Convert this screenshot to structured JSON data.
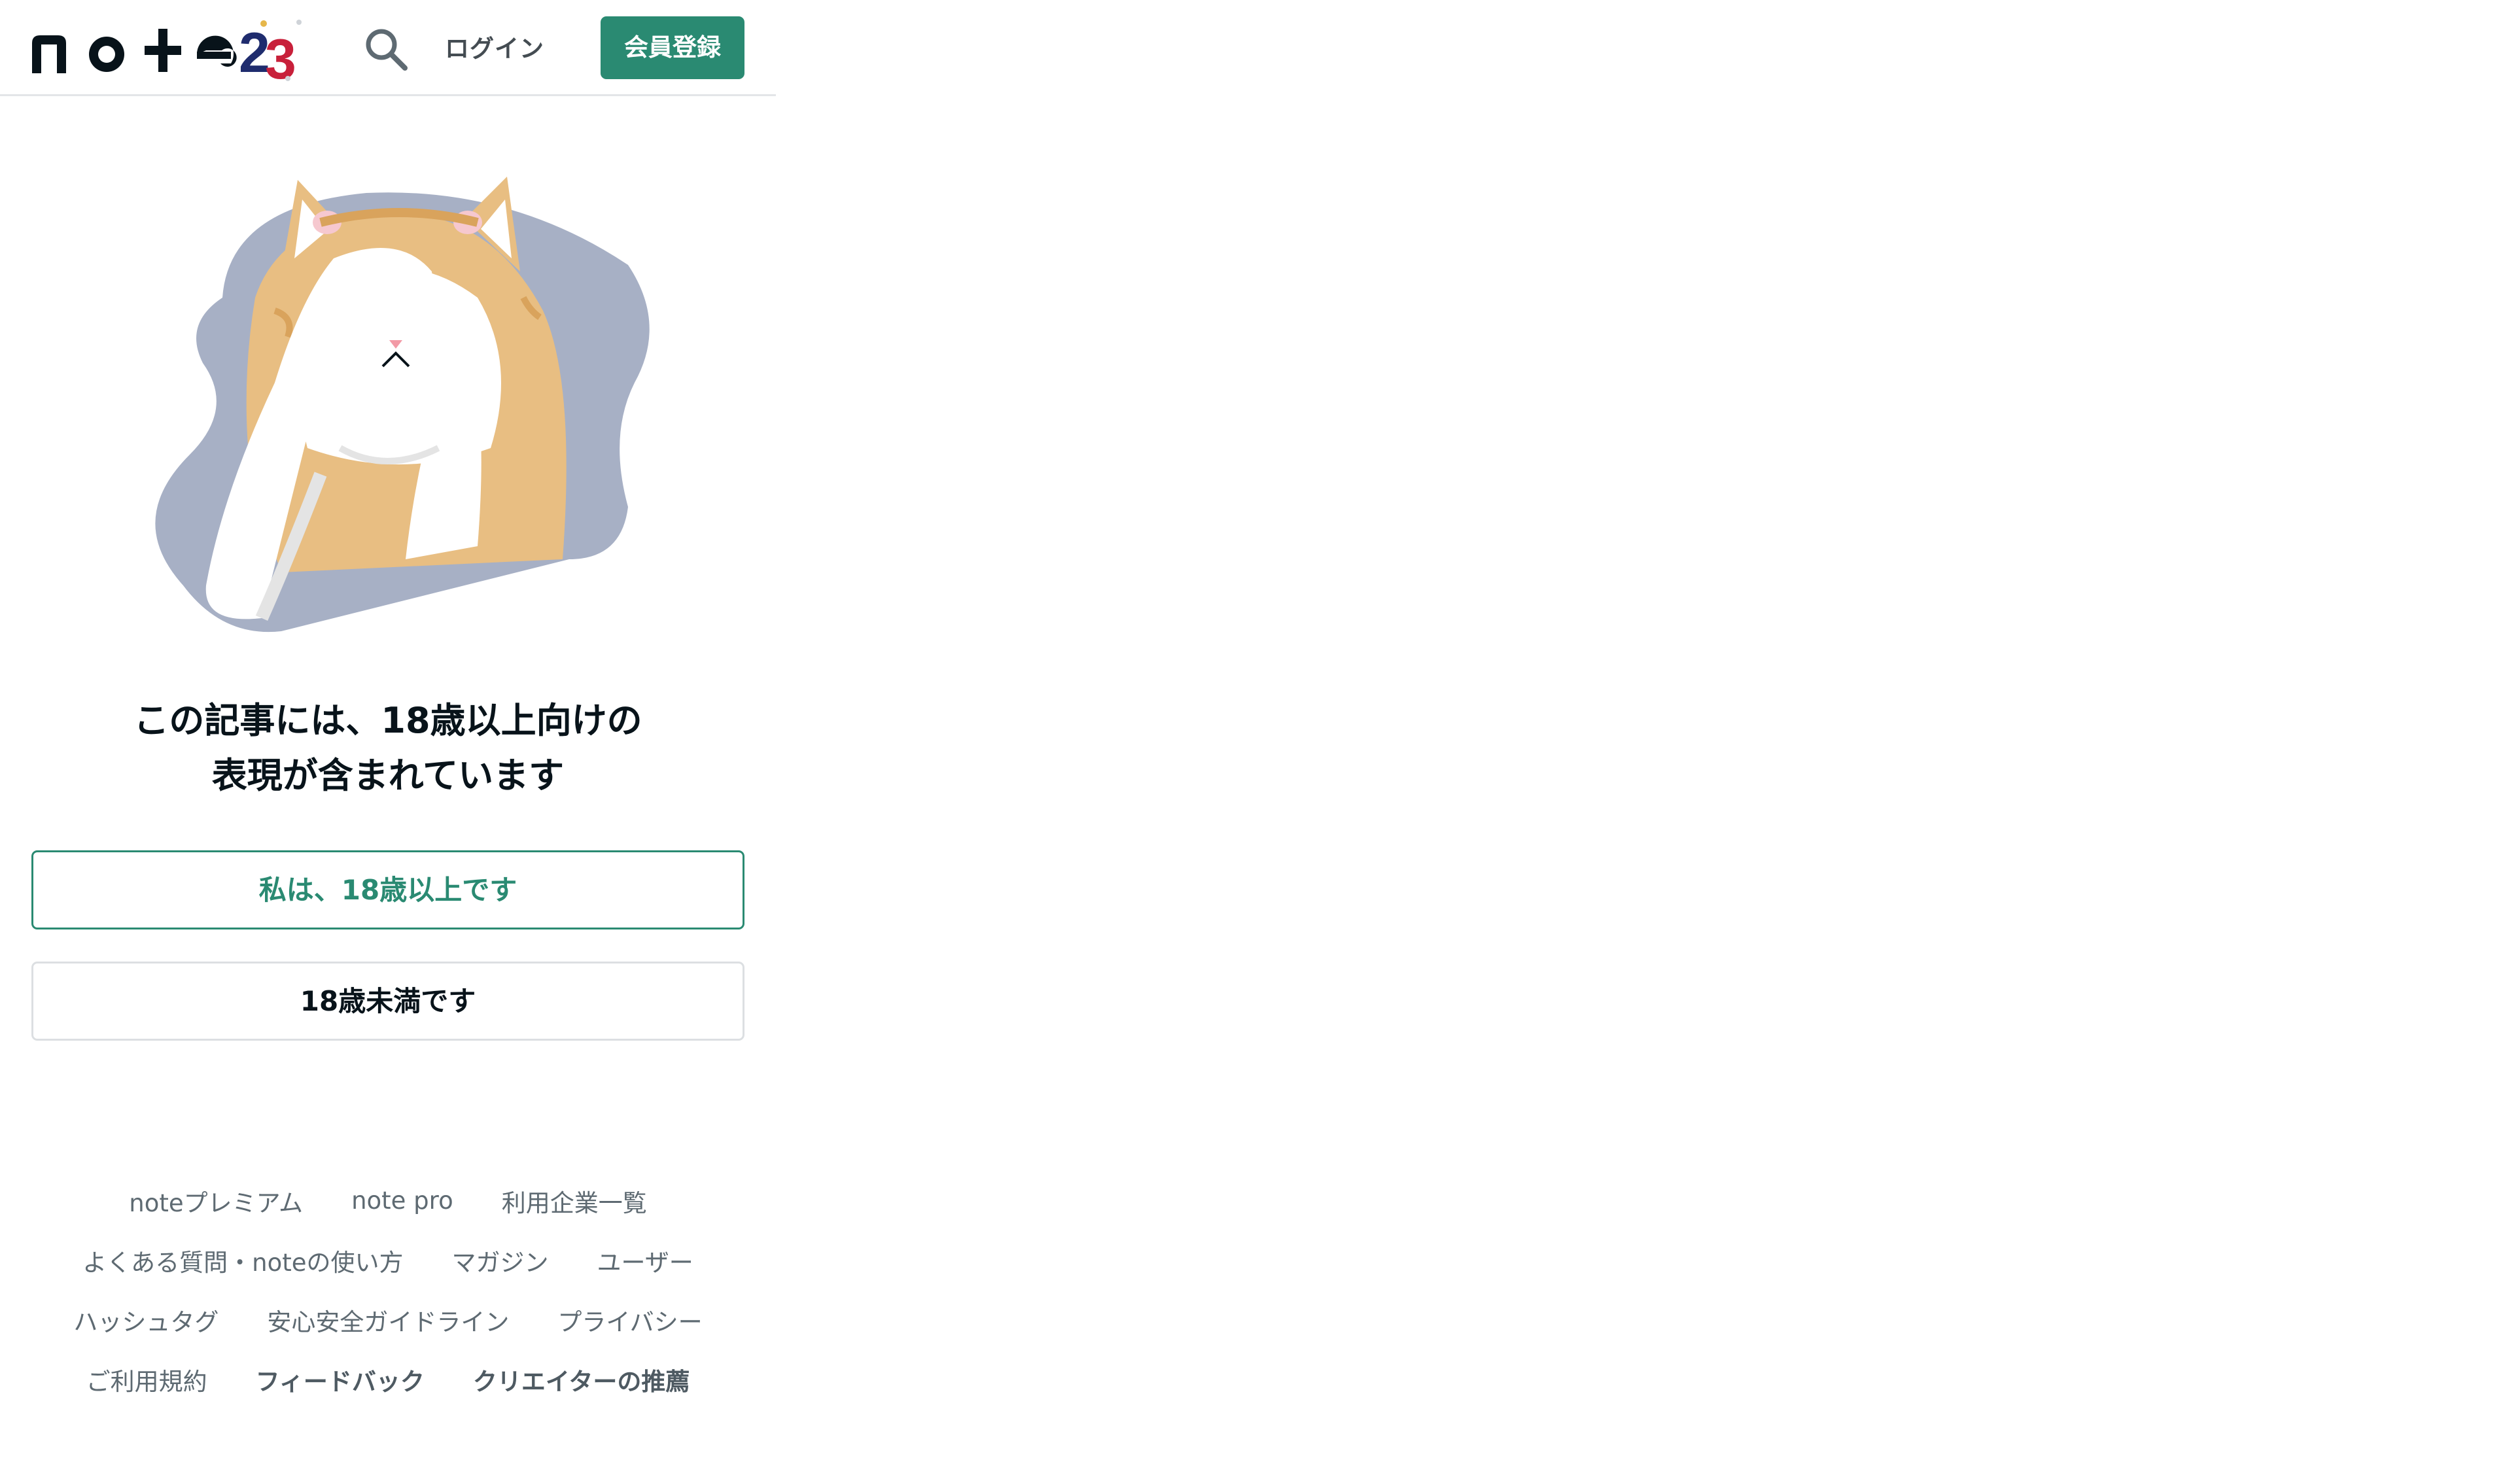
{
  "header": {
    "logo_text": "note",
    "login_label": "ログイン",
    "signup_label": "会員登録"
  },
  "warning": {
    "line1": "この記事には、18歳以上向けの",
    "line2": "表現が含まれています"
  },
  "buttons": {
    "adult": "私は、18歳以上です",
    "minor": "18歳未満です"
  },
  "footer": {
    "rows": [
      [
        "noteプレミアム",
        "note pro",
        "利用企業一覧"
      ],
      [
        "よくある質問・noteの使い方",
        "マガジン",
        "ユーザー"
      ],
      [
        "ハッシュタグ",
        "安心安全ガイドライン",
        "プライバシー"
      ],
      [
        "ご利用規約",
        "フィードバック",
        "クリエイターの推薦"
      ]
    ]
  },
  "colors": {
    "accent": "#2a8a72",
    "text": "#08131a",
    "muted": "#5e6a72",
    "border": "#dcdfe2"
  },
  "icons": [
    "note-logo-icon",
    "search-icon",
    "cat-covering-eyes-illustration"
  ]
}
